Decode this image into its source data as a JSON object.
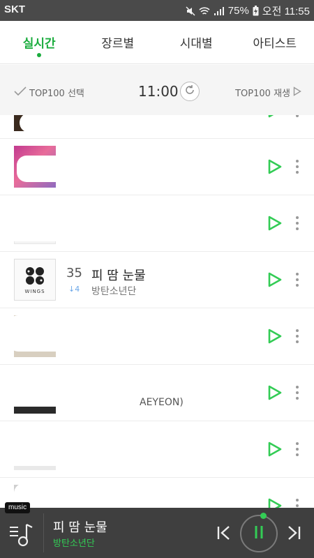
{
  "status_bar": {
    "carrier": "SKT",
    "battery": "75%",
    "time": "오전 11:55"
  },
  "tabs": [
    {
      "label": "실시간",
      "active": true
    },
    {
      "label": "장르별",
      "active": false
    },
    {
      "label": "시대별",
      "active": false
    },
    {
      "label": "아티스트",
      "active": false
    }
  ],
  "controls": {
    "select_label": "TOP100 선택",
    "time": "11:00",
    "play_all_label": "TOP100 재생"
  },
  "list": {
    "rows": [
      {
        "id": "row-0",
        "rank": "",
        "change": "",
        "title": "",
        "artist": "",
        "extra": ""
      },
      {
        "id": "row-1",
        "rank": "",
        "change": "",
        "title": "",
        "artist": "",
        "extra": ""
      },
      {
        "id": "row-2",
        "rank": "",
        "change": "",
        "title": "",
        "artist": "",
        "extra": ""
      },
      {
        "id": "row-3",
        "rank": "35",
        "change": "↓4",
        "title": "피 땀 눈물",
        "artist": "방탄소년단",
        "extra": "",
        "album_text": "WINGS"
      },
      {
        "id": "row-4",
        "rank": "",
        "change": "",
        "title": "",
        "artist": "",
        "extra": ""
      },
      {
        "id": "row-5",
        "rank": "",
        "change": "",
        "title": "",
        "artist": "",
        "extra": "AEYEON)"
      },
      {
        "id": "row-6",
        "rank": "",
        "change": "",
        "title": "",
        "artist": "",
        "extra": ""
      },
      {
        "id": "row-7",
        "rank": "",
        "change": "",
        "title": "",
        "artist": "",
        "extra": ""
      }
    ]
  },
  "player": {
    "tag": "music",
    "title": "피 땀 눈물",
    "artist": "방탄소년단"
  },
  "colors": {
    "accent": "#1aac3d",
    "status_bar": "#4a4a4a",
    "player_bg": "#3f3f3f",
    "player_artist": "#33cc55"
  },
  "icons": [
    "check-icon",
    "refresh-icon",
    "play-triangle-icon",
    "play-icon",
    "more-icon",
    "playlist-icon",
    "prev-icon",
    "pause-icon",
    "next-icon"
  ]
}
